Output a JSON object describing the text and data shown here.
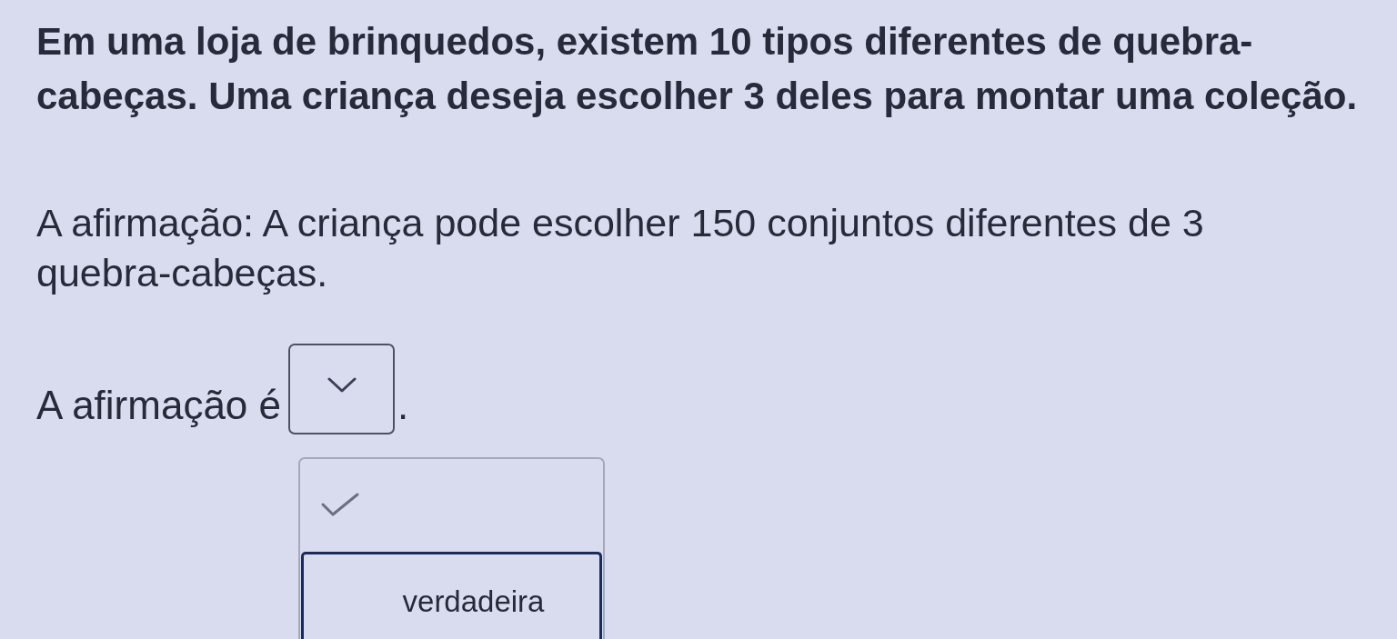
{
  "question": {
    "paragraphs": [
      {
        "text": "Em uma loja de brinquedos, existem 10 tipos diferentes de quebra-cabeças. Uma criança deseja escolher 3 deles para montar uma coleção.",
        "bold": true
      },
      {
        "text": "A afirmação: A criança pode escolher 150 conjuntos diferentes de 3 quebra-cabeças.",
        "bold": false
      }
    ]
  },
  "answer": {
    "prefix": "A afirmação é",
    "suffix": ".",
    "dropdown": {
      "expanded": true
    },
    "options": [
      {
        "kind": "blank",
        "selected": true,
        "focused": false
      },
      {
        "kind": "text",
        "label": "verdadeira",
        "selected": false,
        "focused": true
      }
    ]
  }
}
